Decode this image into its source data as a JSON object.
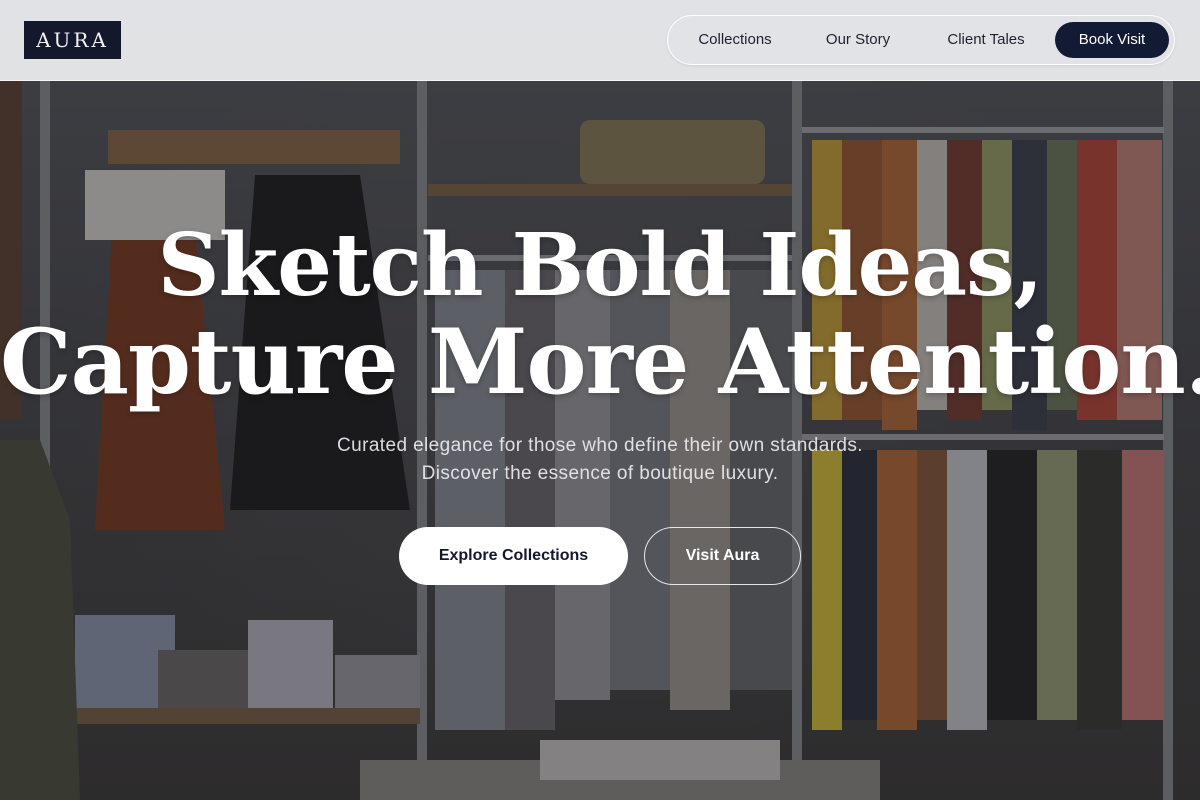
{
  "brand": {
    "logo_text": "AURA"
  },
  "nav": {
    "links": [
      "Collections",
      "Our Story",
      "Client Tales"
    ],
    "cta_label": "Book Visit"
  },
  "hero": {
    "headline_line1": "Sketch Bold Ideas,",
    "headline_line2": "Capture More Attention.",
    "subtitle_line1": "Curated elegance for those who define their own standards.",
    "subtitle_line2": "Discover the essence of boutique luxury.",
    "primary_button": "Explore Collections",
    "secondary_button": "Visit Aura",
    "background_image": "boutique-clothing-racks-photo"
  },
  "colors": {
    "brand_navy": "#14182c",
    "header_bg": "#eeeff1",
    "text_on_dark": "#ffffff"
  }
}
